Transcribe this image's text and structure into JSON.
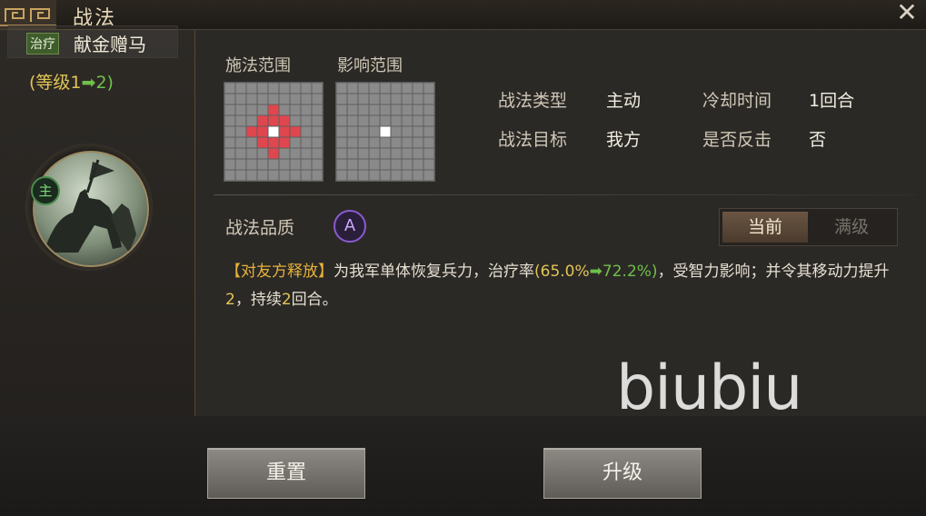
{
  "window": {
    "title": "战法"
  },
  "skill": {
    "tag": "治疗",
    "name": "献金赠马",
    "level_prefix": "(等级1",
    "level_arrow": "➡",
    "level_new": "2)",
    "portrait_badge": "主"
  },
  "ranges": {
    "cast_label": "施法范围",
    "effect_label": "影响范围"
  },
  "info": {
    "type_label": "战法类型",
    "type_value": "主动",
    "cooldown_label": "冷却时间",
    "cooldown_value": "1回合",
    "target_label": "战法目标",
    "target_value": "我方",
    "counter_label": "是否反击",
    "counter_value": "否"
  },
  "quality": {
    "label": "战法品质",
    "grade": "A"
  },
  "toggle": {
    "current": "当前",
    "max": "满级"
  },
  "description": {
    "tag": "【对友方释放】",
    "p1": "为我军单体恢复兵力，治疗率",
    "open": "(",
    "rate_old": "65.0%",
    "arrow": "➡",
    "rate_new": "72.2%",
    "close": ")",
    "p2": "，受智力影响；并令其移动力提升",
    "move": "2",
    "p3": "，持续",
    "dur": "2",
    "p4": "回合。"
  },
  "watermark": "biubiu",
  "buttons": {
    "reset": "重置",
    "upgrade": "升级"
  },
  "colors": {
    "cast_cell": "#e0464e",
    "center_cell": "#ffffff",
    "level_green": "#6fc04a",
    "level_yellow": "#e1c455"
  }
}
